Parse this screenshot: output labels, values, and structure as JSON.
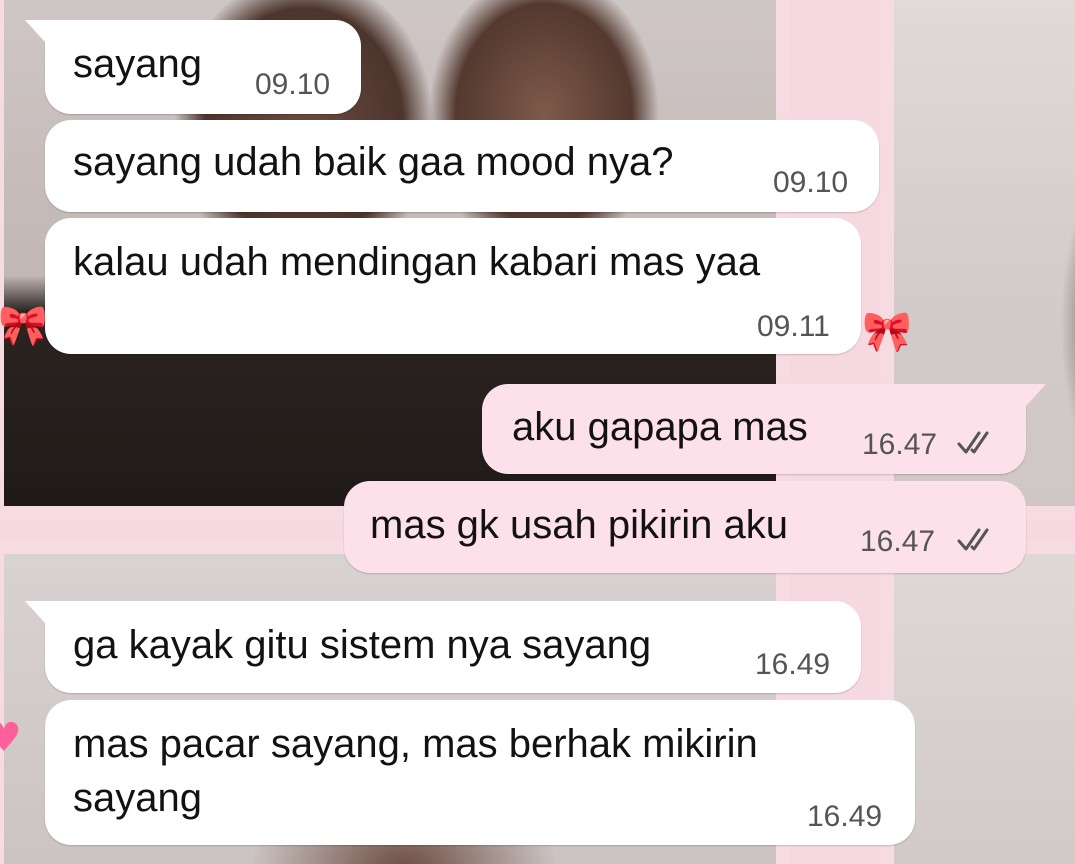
{
  "theme": {
    "incoming_bubble_color": "#ffffff",
    "outgoing_bubble_color": "#fde1ea",
    "text_color": "#121212",
    "timestamp_color": "#555555",
    "tick_icon": "double-check-read-icon"
  },
  "messages": [
    {
      "direction": "incoming",
      "text": "sayang",
      "time": "09.10"
    },
    {
      "direction": "incoming",
      "text": "sayang udah baik gaa mood nya?",
      "time": "09.10"
    },
    {
      "direction": "incoming",
      "text": "kalau udah mendingan kabari mas yaa",
      "time": "09.11"
    },
    {
      "direction": "outgoing",
      "text": "aku gapapa mas",
      "time": "16.47",
      "status": "read"
    },
    {
      "direction": "outgoing",
      "text": "mas gk usah pikirin aku",
      "time": "16.47",
      "status": "read"
    },
    {
      "direction": "incoming",
      "text": "ga kayak gitu sistem nya sayang",
      "time": "16.49"
    },
    {
      "direction": "incoming",
      "text_line1": "mas pacar sayang, mas berhak mikirin",
      "text_line2": "sayang",
      "time": "16.49"
    }
  ]
}
